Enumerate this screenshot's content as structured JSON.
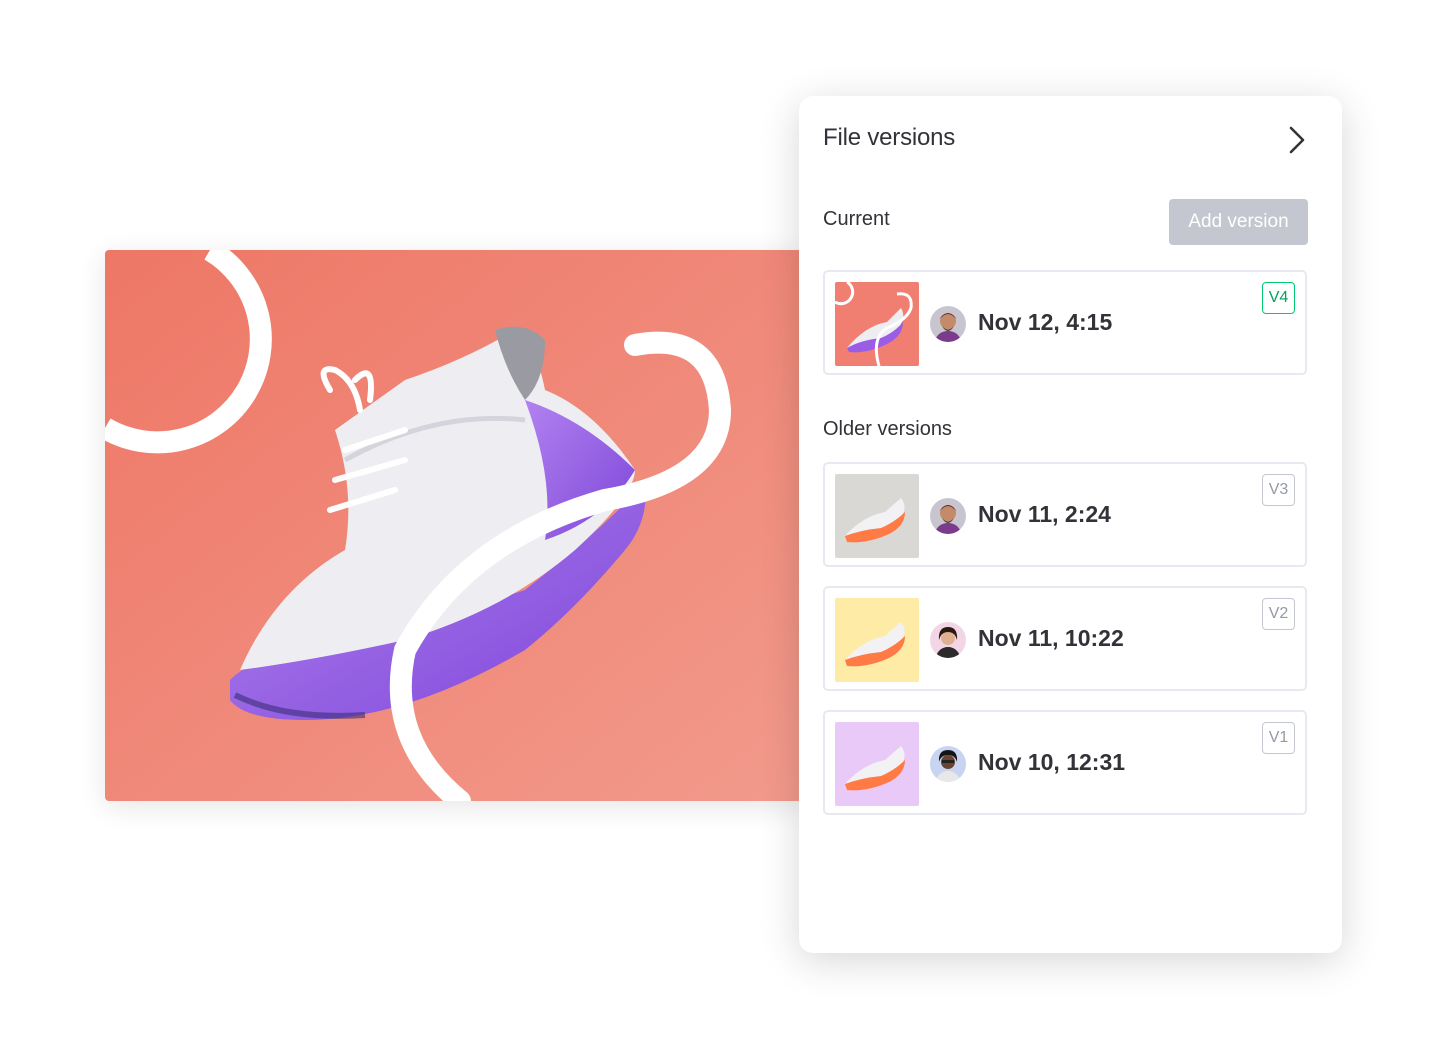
{
  "panel": {
    "title": "File versions",
    "current_label": "Current",
    "add_version_label": "Add version",
    "older_label": "Older versions"
  },
  "current_version": {
    "date": "Nov 12, 4:15",
    "badge": "V4",
    "thumb_bg": "#f07f72"
  },
  "older_versions": [
    {
      "date": "Nov 11, 2:24",
      "badge": "V3",
      "thumb_bg": "#d9d8d4"
    },
    {
      "date": "Nov 11, 10:22",
      "badge": "V2",
      "thumb_bg": "#fdeba6"
    },
    {
      "date": "Nov 10, 12:31",
      "badge": "V1",
      "thumb_bg": "#e9c9f7"
    }
  ],
  "colors": {
    "preview_bg": "#f08376",
    "sole_accent": "#9b5de5",
    "badge_current": "#00ca72",
    "button_disabled": "#c5c7d0"
  },
  "icons": {
    "panel_close": "chevron-right-icon"
  }
}
